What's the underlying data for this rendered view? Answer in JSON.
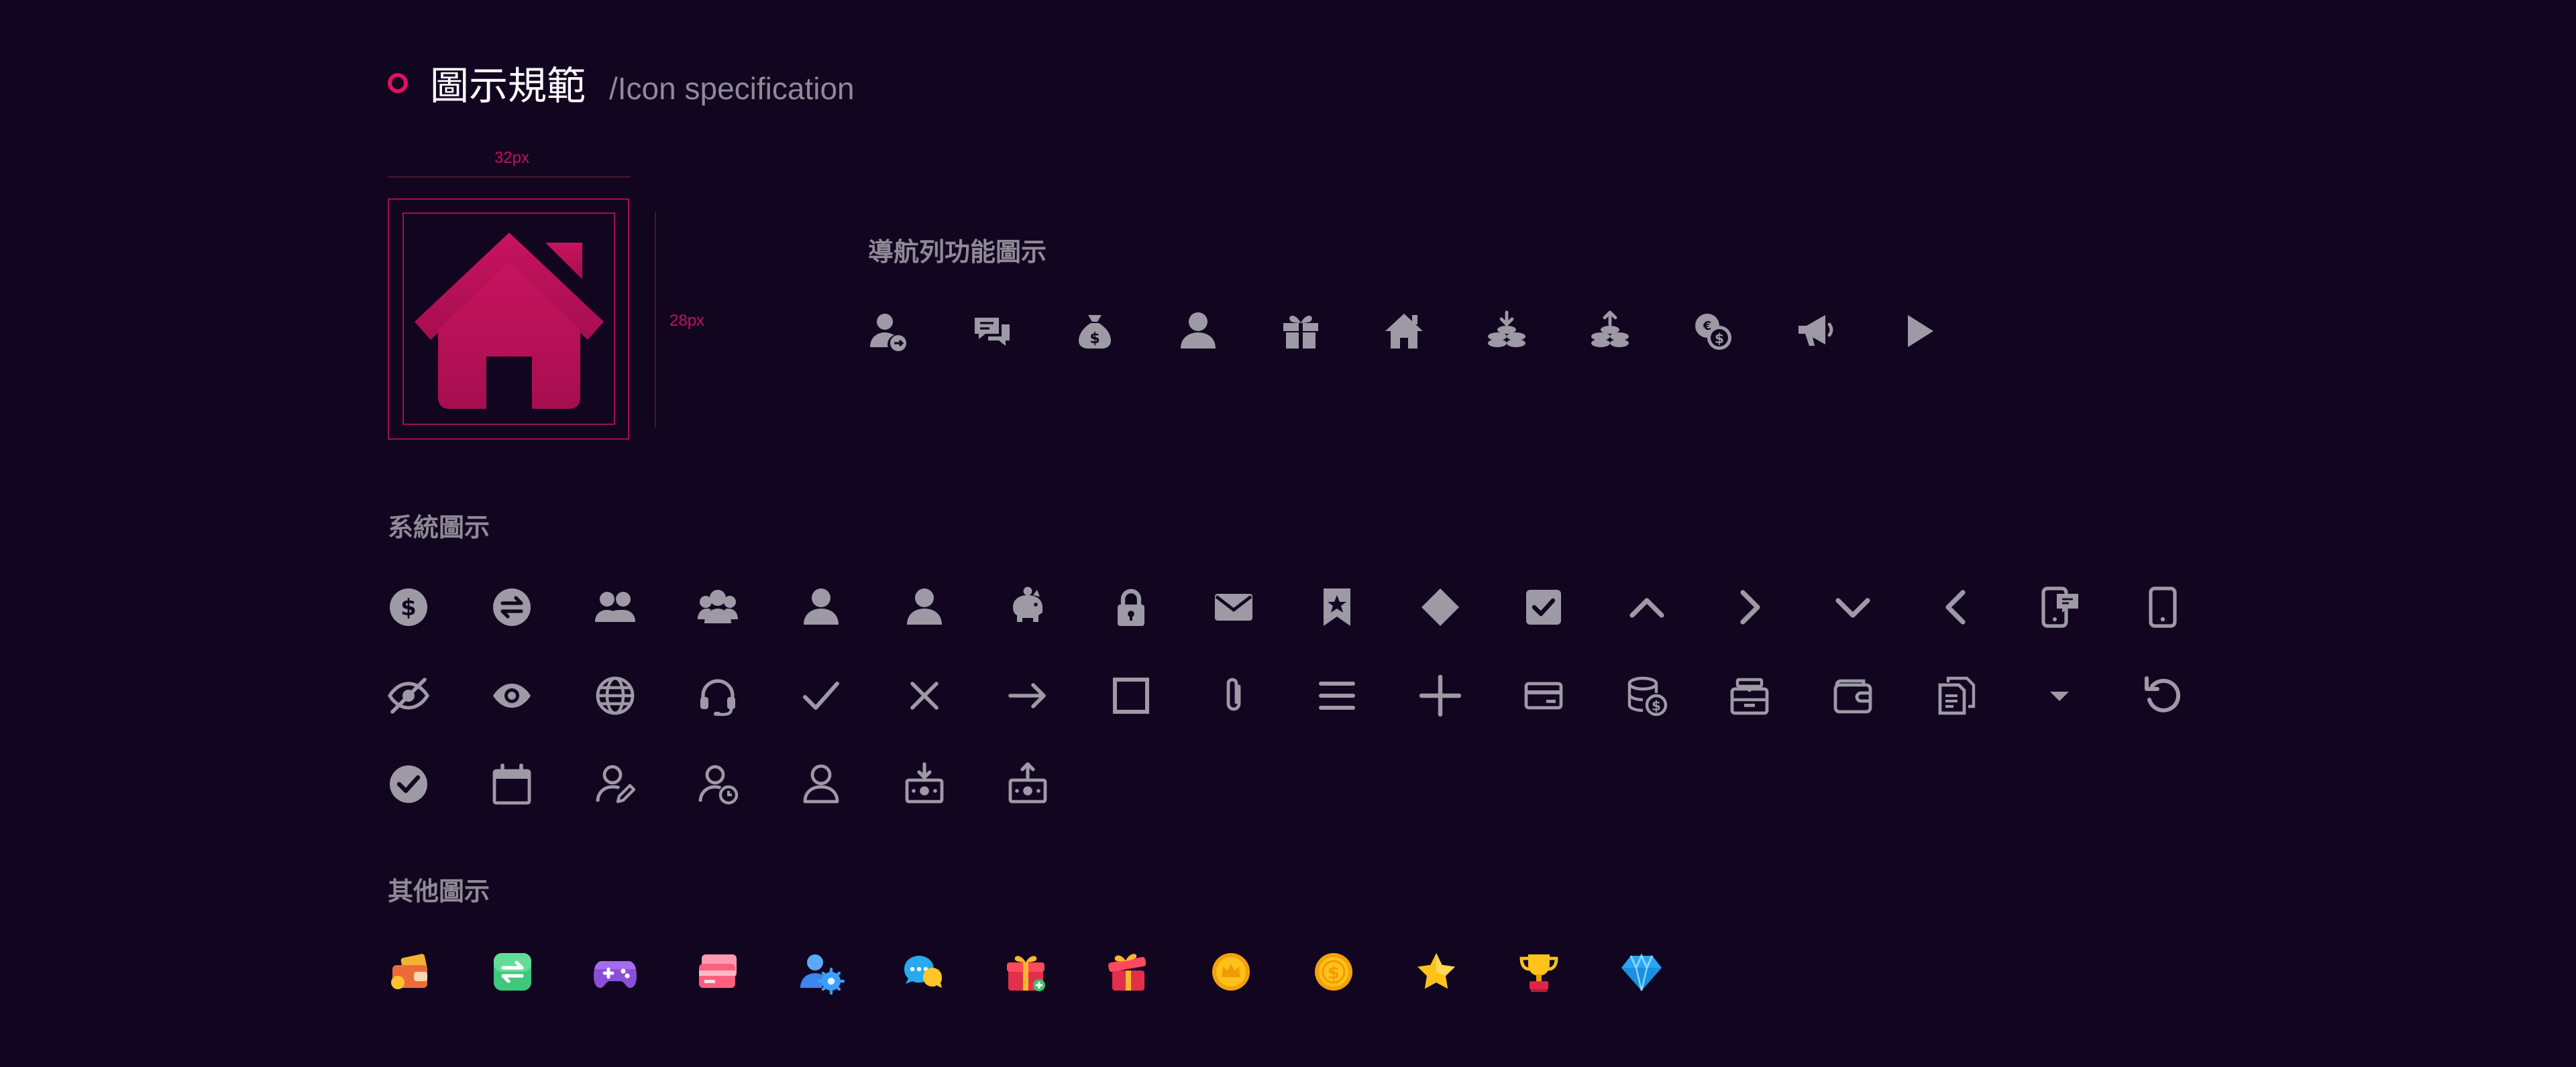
{
  "header": {
    "title": "圖示規範",
    "subtitle": "/Icon specification"
  },
  "spec": {
    "width_label": "32px",
    "height_label": "28px",
    "sample_icon": "home-icon",
    "sample_color": "#c1125a"
  },
  "sections": {
    "nav_title": "導航列功能圖示",
    "system_title": "系統圖示",
    "other_title": "其他圖示"
  },
  "colors": {
    "background": "#120520",
    "icon_gray": "#9d9aa5",
    "accent": "#e0115f"
  },
  "nav_icons": [
    "user-transfer-icon",
    "chat-icon",
    "money-bag-icon",
    "user-icon",
    "gift-icon",
    "home-icon",
    "coins-deposit-icon",
    "coins-withdraw-icon",
    "currency-exchange-icon",
    "megaphone-icon",
    "play-icon"
  ],
  "system_icons_row1": [
    "dollar-circle-icon",
    "transfer-circle-icon",
    "users-icon",
    "user-group-icon",
    "user-icon",
    "user-icon",
    "piggy-bank-icon",
    "lock-icon",
    "mail-icon",
    "bookmark-star-icon",
    "diamond-icon",
    "checkbox-icon",
    "chevron-up-icon",
    "chevron-right-icon",
    "chevron-down-icon",
    "chevron-left-icon",
    "mobile-chat-icon",
    "mobile-icon"
  ],
  "system_icons_row2": [
    "eye-off-icon",
    "eye-icon",
    "globe-icon",
    "headset-icon",
    "check-icon",
    "close-icon",
    "arrow-right-icon",
    "square-icon",
    "paperclip-icon",
    "menu-icon",
    "plus-icon",
    "card-icon",
    "coin-database-icon",
    "cashier-icon",
    "wallet-icon",
    "copy-document-icon",
    "caret-down-icon",
    "refresh-icon"
  ],
  "system_icons_row3": [
    "check-circle-icon",
    "calendar-icon",
    "user-edit-icon",
    "user-clock-icon",
    "user-outline-icon",
    "cash-in-icon",
    "cash-out-icon"
  ],
  "other_icons": [
    "wallet-color-icon",
    "exchange-color-icon",
    "gamepad-color-icon",
    "cards-color-icon",
    "user-settings-color-icon",
    "chat-bubbles-color-icon",
    "gift-box-color-icon",
    "gift-box-open-color-icon",
    "coin-crown-color-icon",
    "coin-dollar-color-icon",
    "star-color-icon",
    "trophy-color-icon",
    "gem-color-icon"
  ]
}
